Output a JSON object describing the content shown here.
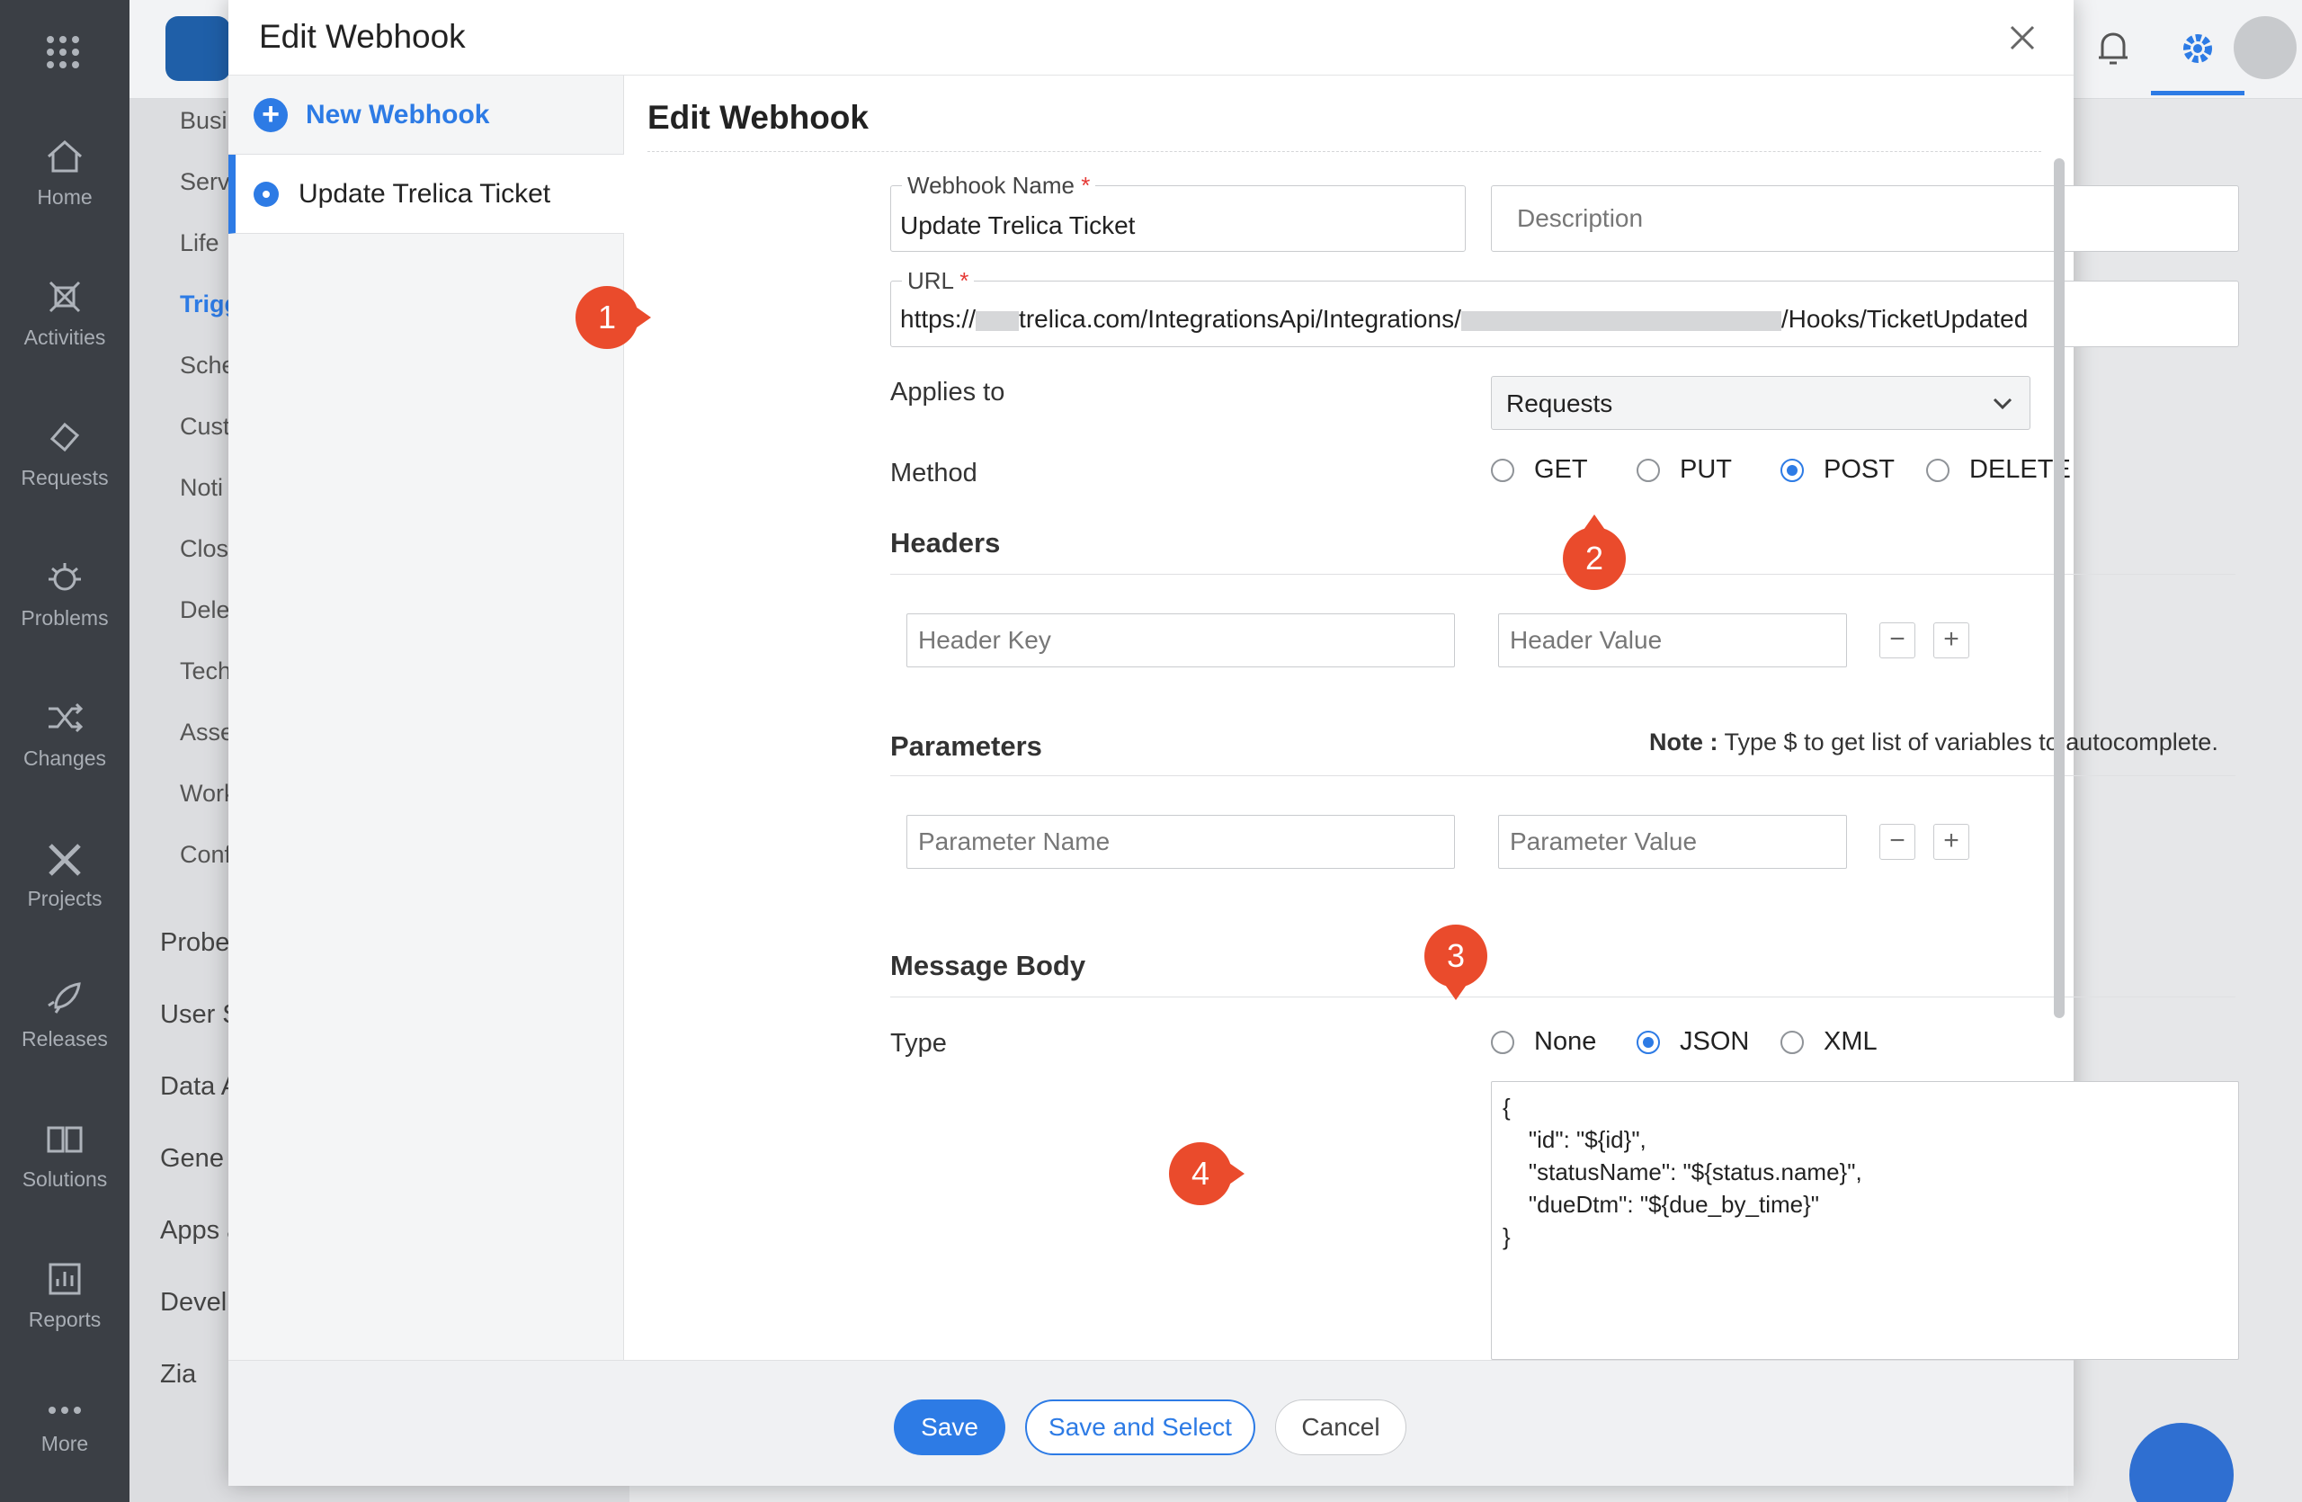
{
  "nav": {
    "items": [
      {
        "label": "Home",
        "icon": "home-icon"
      },
      {
        "label": "Activities",
        "icon": "activities-icon"
      },
      {
        "label": "Requests",
        "icon": "ticket-icon"
      },
      {
        "label": "Problems",
        "icon": "bug-icon"
      },
      {
        "label": "Changes",
        "icon": "shuffle-icon"
      },
      {
        "label": "Projects",
        "icon": "projects-icon"
      },
      {
        "label": "Releases",
        "icon": "rocket-icon"
      },
      {
        "label": "Solutions",
        "icon": "book-icon"
      },
      {
        "label": "Reports",
        "icon": "chart-icon"
      },
      {
        "label": "More",
        "icon": "more-icon"
      }
    ]
  },
  "background": {
    "menu": [
      "Busi",
      "Serv",
      "Life",
      "Trigg",
      "Sche",
      "Cust",
      "Noti",
      "Clos",
      "Dele",
      "Tech",
      "Asse",
      "Work",
      "Conf"
    ],
    "menu2": [
      "Probe",
      "User S",
      "Data A",
      "Gene",
      "Apps a",
      "Devel",
      "Zia"
    ]
  },
  "modal": {
    "title": "Edit Webhook",
    "list": {
      "new_label": "New Webhook",
      "item_label": "Update Trelica Ticket"
    },
    "form": {
      "title": "Edit Webhook",
      "name_label": "Webhook Name",
      "name_value": "Update Trelica Ticket",
      "required_mark": "*",
      "description_placeholder": "Description",
      "url_label": "URL",
      "url_prefix": "https://",
      "url_mid": "trelica.com/IntegrationsApi/Integrations/",
      "url_suffix": "/Hooks/TicketUpdated",
      "applies_label": "Applies to",
      "applies_value": "Requests",
      "method_label": "Method",
      "methods": [
        {
          "label": "GET",
          "selected": false
        },
        {
          "label": "PUT",
          "selected": false
        },
        {
          "label": "POST",
          "selected": true
        },
        {
          "label": "DELETE",
          "selected": false
        }
      ],
      "headers_title": "Headers",
      "header_key_placeholder": "Header Key",
      "header_value_placeholder": "Header Value",
      "parameters_title": "Parameters",
      "note_label": "Note :",
      "note_text": " Type $ to get list of variables to autocomplete.",
      "param_name_placeholder": "Parameter Name",
      "param_value_placeholder": "Parameter Value",
      "minus": "−",
      "plus": "+",
      "body_title": "Message Body",
      "type_label": "Type",
      "types": [
        {
          "label": "None",
          "selected": false
        },
        {
          "label": "JSON",
          "selected": true
        },
        {
          "label": "XML",
          "selected": false
        }
      ],
      "body_value": "{\n    \"id\": \"${id}\",\n    \"statusName\": \"${status.name}\",\n    \"dueDtm\": \"${due_by_time}\"\n}"
    },
    "footer": {
      "save": "Save",
      "save_select": "Save and Select",
      "cancel": "Cancel"
    }
  },
  "callouts": [
    "1",
    "2",
    "3",
    "4"
  ],
  "colors": {
    "accent": "#2d7be5",
    "callout": "#ea4b2c",
    "required": "#e53935"
  }
}
